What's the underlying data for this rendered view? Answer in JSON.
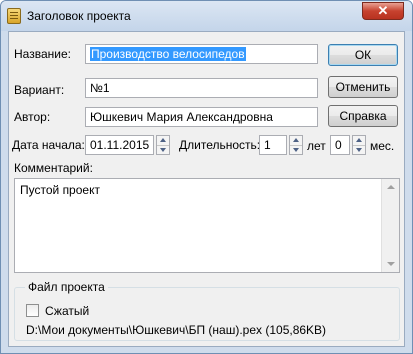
{
  "window": {
    "title": "Заголовок проекта",
    "close_glyph": "✕"
  },
  "form": {
    "name_label": "Название:",
    "name_value": "Производство велосипедов",
    "variant_label": "Вариант:",
    "variant_value": "№1",
    "author_label": "Автор:",
    "author_value": "Юшкевич Мария Александровна",
    "start_label": "Дата начала:",
    "start_value": "01.11.2015",
    "duration_label": "Длительность:",
    "years_value": "1",
    "years_unit": "лет",
    "months_value": "0",
    "months_unit": "мес.",
    "comment_label": "Комментарий:",
    "comment_value": "Пустой проект"
  },
  "buttons": {
    "ok": "ОК",
    "cancel": "Отменить",
    "help": "Справка"
  },
  "file_group": {
    "title": "Файл проекта",
    "compressed_label": "Сжатый",
    "compressed_checked": false,
    "path": "D:\\Мои документы\\Юшкевич\\БП (наш).pex (105,86KB)"
  }
}
